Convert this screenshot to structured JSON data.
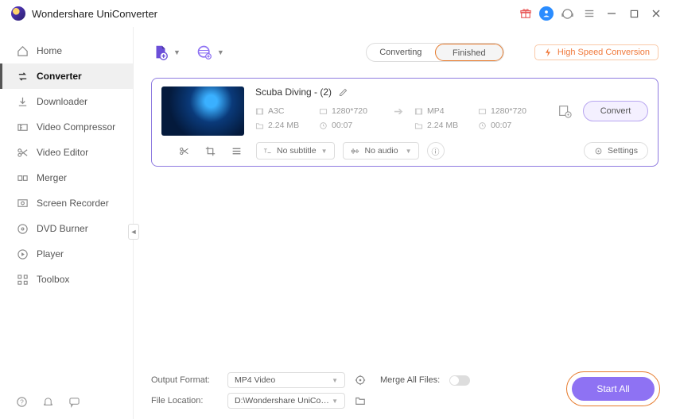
{
  "app": {
    "title": "Wondershare UniConverter"
  },
  "sidebar": {
    "items": [
      {
        "label": "Home"
      },
      {
        "label": "Converter"
      },
      {
        "label": "Downloader"
      },
      {
        "label": "Video Compressor"
      },
      {
        "label": "Video Editor"
      },
      {
        "label": "Merger"
      },
      {
        "label": "Screen Recorder"
      },
      {
        "label": "DVD Burner"
      },
      {
        "label": "Player"
      },
      {
        "label": "Toolbox"
      }
    ]
  },
  "tabs": {
    "converting": "Converting",
    "finished": "Finished"
  },
  "hs_conversion": "High Speed Conversion",
  "card": {
    "title": "Scuba Diving - (2)",
    "src": {
      "format": "A3C",
      "res": "1280*720",
      "size": "2.24 MB",
      "dur": "00:07"
    },
    "dst": {
      "format": "MP4",
      "res": "1280*720",
      "size": "2.24 MB",
      "dur": "00:07"
    },
    "subtitle": "No subtitle",
    "audio": "No audio",
    "settings": "Settings",
    "convert": "Convert"
  },
  "footer": {
    "output_format_label": "Output Format:",
    "output_format": "MP4 Video",
    "merge_label": "Merge All Files:",
    "file_location_label": "File Location:",
    "file_location": "D:\\Wondershare UniConverter",
    "start_all": "Start All"
  }
}
